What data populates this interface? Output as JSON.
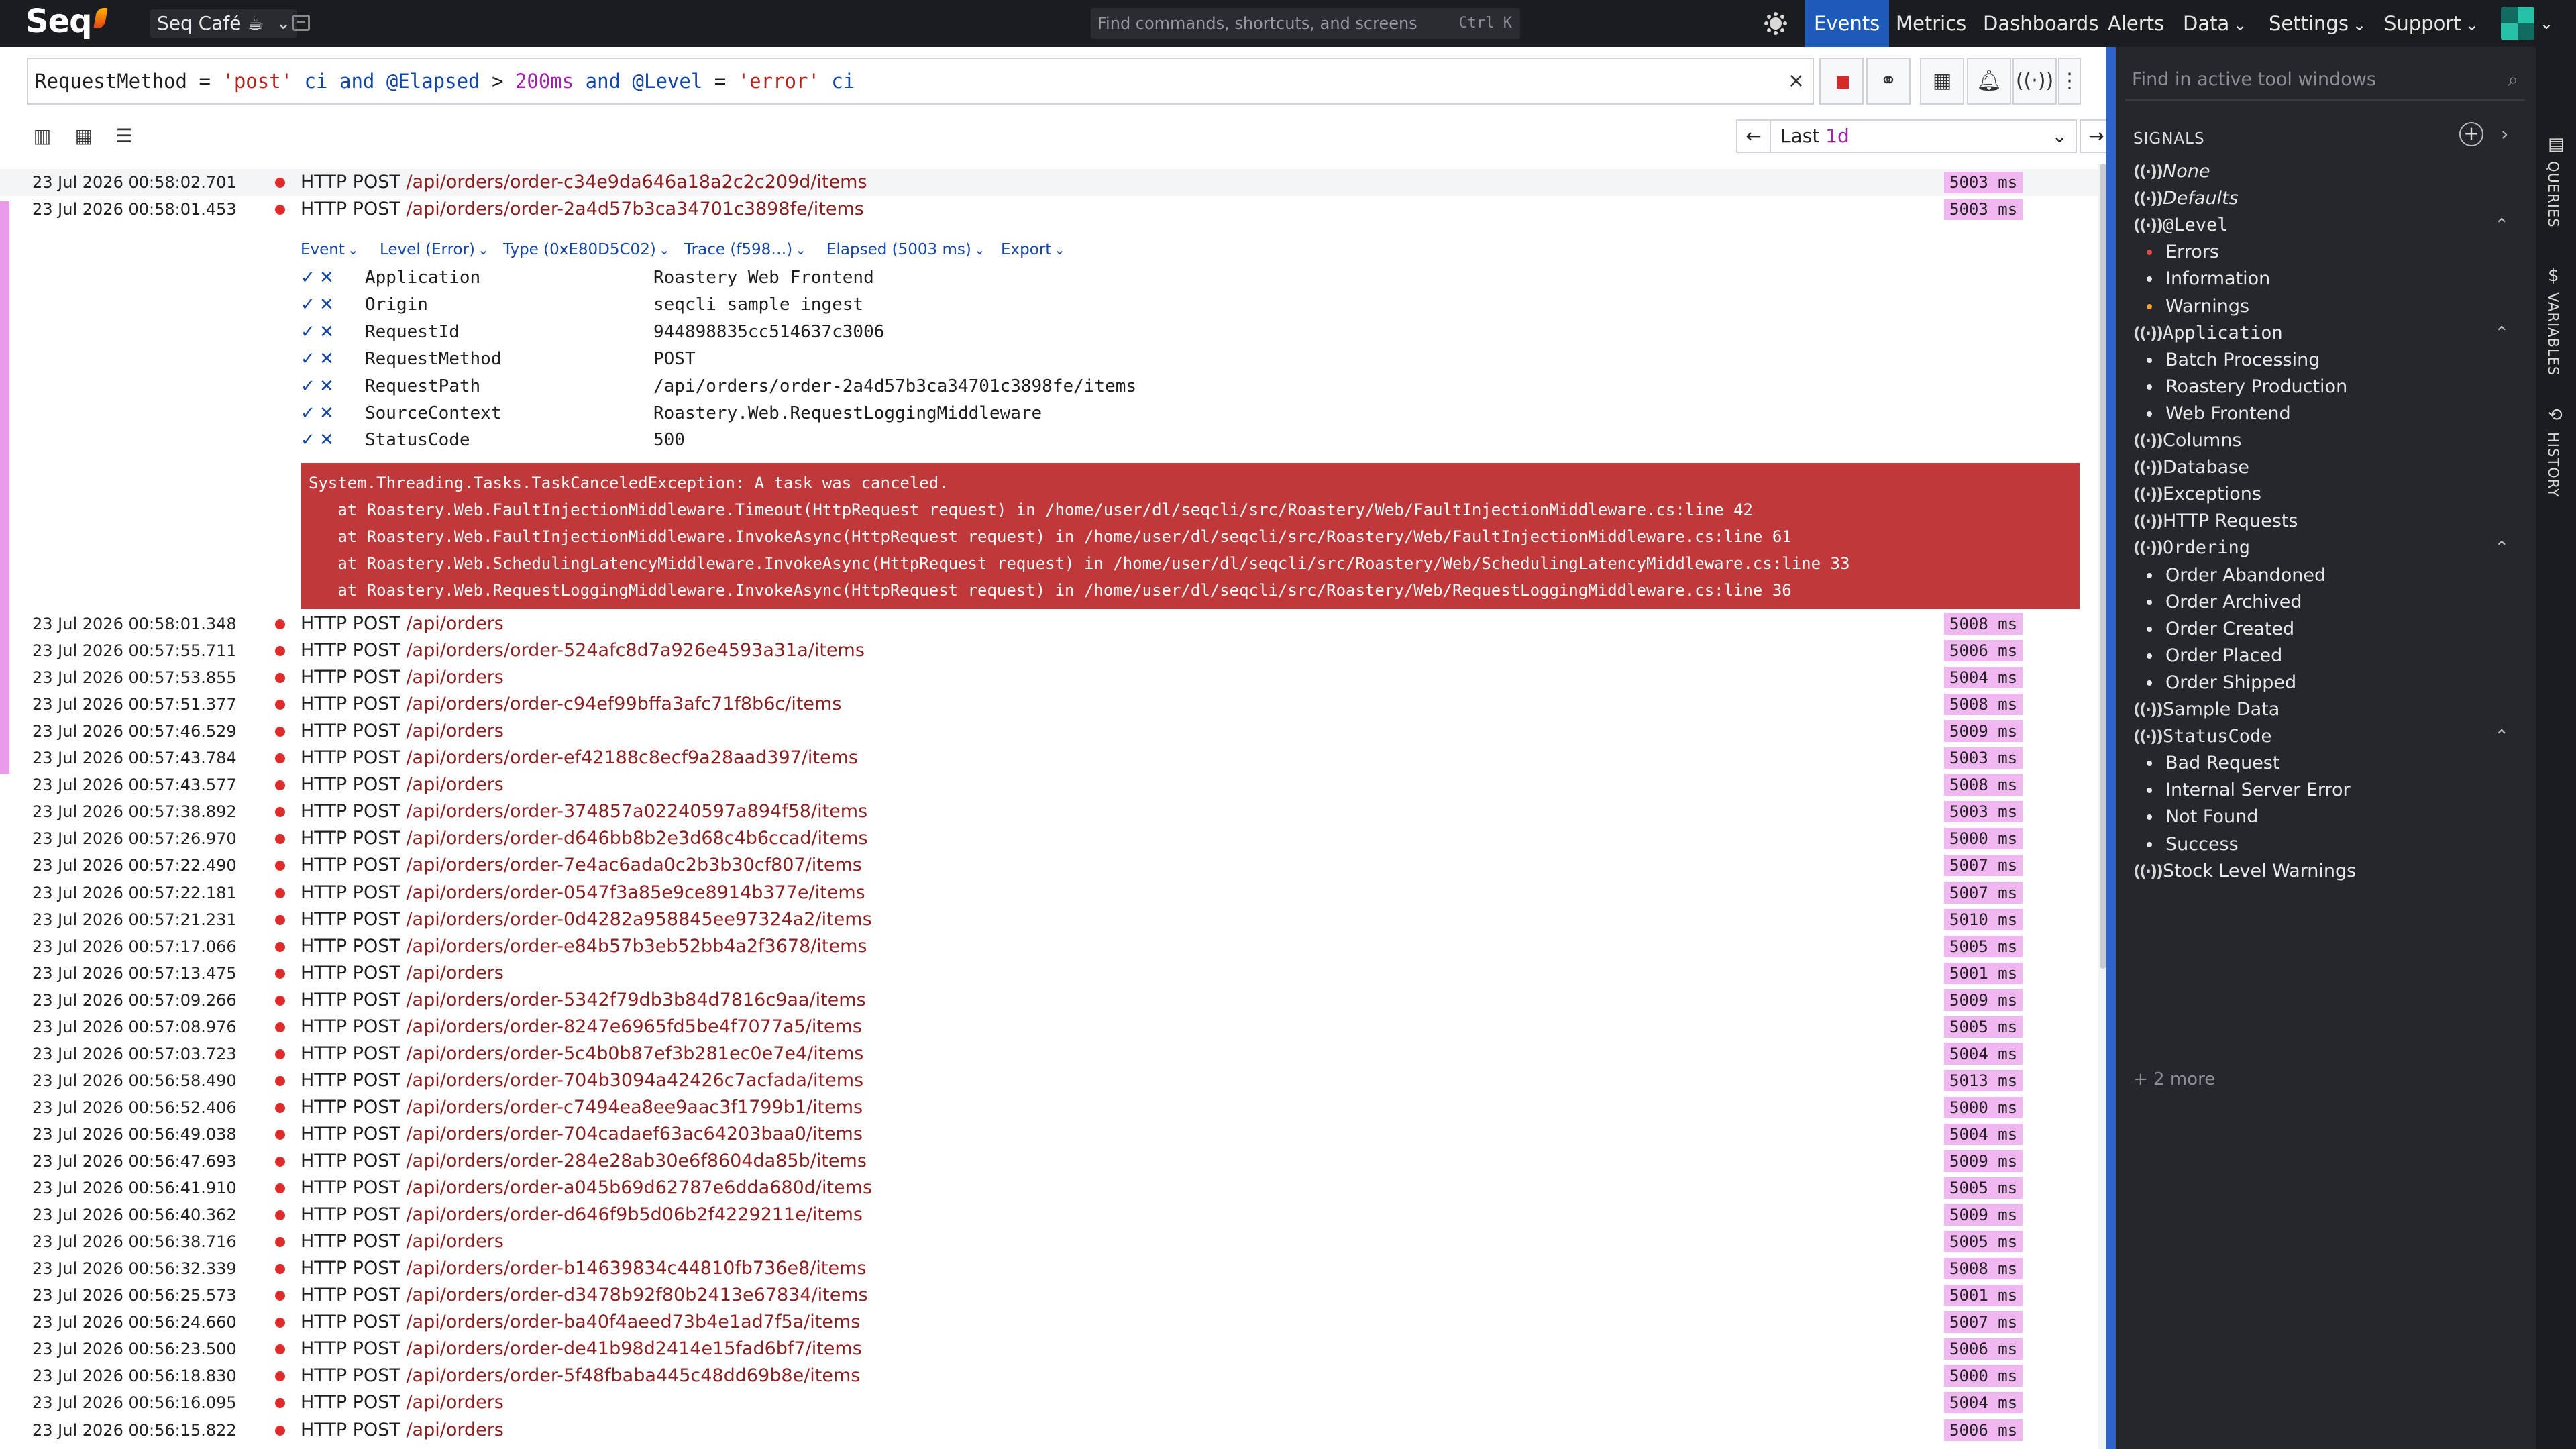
{
  "app": {
    "logo": "Seq",
    "workspace": "Seq Café ☕"
  },
  "command_search": {
    "placeholder": "Find commands, shortcuts, and screens",
    "shortcut": "Ctrl K"
  },
  "nav": {
    "items": [
      {
        "label": "Events",
        "active": true,
        "dropdown": false
      },
      {
        "label": "Metrics",
        "dropdown": false
      },
      {
        "label": "Dashboards",
        "dropdown": false
      },
      {
        "label": "Alerts",
        "dropdown": false
      },
      {
        "label": "Data",
        "dropdown": true
      },
      {
        "label": "Settings",
        "dropdown": true
      },
      {
        "label": "Support",
        "dropdown": true
      }
    ]
  },
  "query": {
    "tokens": [
      {
        "text": "RequestMethod",
        "kind": "plain"
      },
      {
        "text": " = ",
        "kind": "plain"
      },
      {
        "text": "'post'",
        "kind": "str"
      },
      {
        "text": " ci ",
        "kind": "kw"
      },
      {
        "text": "and",
        "kind": "kw"
      },
      {
        "text": " @Elapsed ",
        "kind": "kw"
      },
      {
        "text": "> ",
        "kind": "plain"
      },
      {
        "text": "200ms",
        "kind": "num"
      },
      {
        "text": " and ",
        "kind": "kw"
      },
      {
        "text": "@Level",
        "kind": "kw"
      },
      {
        "text": " = ",
        "kind": "plain"
      },
      {
        "text": "'error'",
        "kind": "str"
      },
      {
        "text": " ci",
        "kind": "kw"
      }
    ],
    "clear_icon": "×"
  },
  "range": {
    "prefix": "Last ",
    "value": "1d"
  },
  "expanded_event": {
    "tabs": [
      "Event",
      "Level (Error)",
      "Type (0xE80D5C02)",
      "Trace (f598…)",
      "Elapsed (5003 ms)",
      "Export"
    ],
    "properties": [
      {
        "name": "Application",
        "value": "Roastery Web Frontend"
      },
      {
        "name": "Origin",
        "value": "seqcli sample ingest"
      },
      {
        "name": "RequestId",
        "value": "944898835cc514637c3006"
      },
      {
        "name": "RequestMethod",
        "value": "POST"
      },
      {
        "name": "RequestPath",
        "value": "/api/orders/order-2a4d57b3ca34701c3898fe/items"
      },
      {
        "name": "SourceContext",
        "value": "Roastery.Web.RequestLoggingMiddleware"
      },
      {
        "name": "StatusCode",
        "value": "500"
      }
    ],
    "exception": [
      "System.Threading.Tasks.TaskCanceledException: A task was canceled.",
      "   at Roastery.Web.FaultInjectionMiddleware.Timeout(HttpRequest request) in /home/user/dl/seqcli/src/Roastery/Web/FaultInjectionMiddleware.cs:line 42",
      "   at Roastery.Web.FaultInjectionMiddleware.InvokeAsync(HttpRequest request) in /home/user/dl/seqcli/src/Roastery/Web/FaultInjectionMiddleware.cs:line 61",
      "   at Roastery.Web.SchedulingLatencyMiddleware.InvokeAsync(HttpRequest request) in /home/user/dl/seqcli/src/Roastery/Web/SchedulingLatencyMiddleware.cs:line 33",
      "   at Roastery.Web.RequestLoggingMiddleware.InvokeAsync(HttpRequest request) in /home/user/dl/seqcli/src/Roastery/Web/RequestLoggingMiddleware.cs:line 36"
    ]
  },
  "events": [
    {
      "ts": "23 Jul 2026  00:58:02.701",
      "method": "HTTP POST",
      "path": "/api/orders/order-c34e9da646a18a2c2c209d/items",
      "elapsed": "5003 ms"
    },
    {
      "ts": "23 Jul 2026  00:58:01.453",
      "method": "HTTP POST",
      "path": "/api/orders/order-2a4d57b3ca34701c3898fe/items",
      "elapsed": "5003 ms"
    },
    {
      "ts": "23 Jul 2026  00:58:01.348",
      "method": "HTTP POST",
      "path": "/api/orders",
      "elapsed": "5008 ms"
    },
    {
      "ts": "23 Jul 2026  00:57:55.711",
      "method": "HTTP POST",
      "path": "/api/orders/order-524afc8d7a926e4593a31a/items",
      "elapsed": "5006 ms"
    },
    {
      "ts": "23 Jul 2026  00:57:53.855",
      "method": "HTTP POST",
      "path": "/api/orders",
      "elapsed": "5004 ms"
    },
    {
      "ts": "23 Jul 2026  00:57:51.377",
      "method": "HTTP POST",
      "path": "/api/orders/order-c94ef99bffa3afc71f8b6c/items",
      "elapsed": "5008 ms"
    },
    {
      "ts": "23 Jul 2026  00:57:46.529",
      "method": "HTTP POST",
      "path": "/api/orders",
      "elapsed": "5009 ms"
    },
    {
      "ts": "23 Jul 2026  00:57:43.784",
      "method": "HTTP POST",
      "path": "/api/orders/order-ef42188c8ecf9a28aad397/items",
      "elapsed": "5003 ms"
    },
    {
      "ts": "23 Jul 2026  00:57:43.577",
      "method": "HTTP POST",
      "path": "/api/orders",
      "elapsed": "5008 ms"
    },
    {
      "ts": "23 Jul 2026  00:57:38.892",
      "method": "HTTP POST",
      "path": "/api/orders/order-374857a02240597a894f58/items",
      "elapsed": "5003 ms"
    },
    {
      "ts": "23 Jul 2026  00:57:26.970",
      "method": "HTTP POST",
      "path": "/api/orders/order-d646bb8b2e3d68c4b6ccad/items",
      "elapsed": "5000 ms"
    },
    {
      "ts": "23 Jul 2026  00:57:22.490",
      "method": "HTTP POST",
      "path": "/api/orders/order-7e4ac6ada0c2b3b30cf807/items",
      "elapsed": "5007 ms"
    },
    {
      "ts": "23 Jul 2026  00:57:22.181",
      "method": "HTTP POST",
      "path": "/api/orders/order-0547f3a85e9ce8914b377e/items",
      "elapsed": "5007 ms"
    },
    {
      "ts": "23 Jul 2026  00:57:21.231",
      "method": "HTTP POST",
      "path": "/api/orders/order-0d4282a958845ee97324a2/items",
      "elapsed": "5010 ms"
    },
    {
      "ts": "23 Jul 2026  00:57:17.066",
      "method": "HTTP POST",
      "path": "/api/orders/order-e84b57b3eb52bb4a2f3678/items",
      "elapsed": "5005 ms"
    },
    {
      "ts": "23 Jul 2026  00:57:13.475",
      "method": "HTTP POST",
      "path": "/api/orders",
      "elapsed": "5001 ms"
    },
    {
      "ts": "23 Jul 2026  00:57:09.266",
      "method": "HTTP POST",
      "path": "/api/orders/order-5342f79db3b84d7816c9aa/items",
      "elapsed": "5009 ms"
    },
    {
      "ts": "23 Jul 2026  00:57:08.976",
      "method": "HTTP POST",
      "path": "/api/orders/order-8247e6965fd5be4f7077a5/items",
      "elapsed": "5005 ms"
    },
    {
      "ts": "23 Jul 2026  00:57:03.723",
      "method": "HTTP POST",
      "path": "/api/orders/order-5c4b0b87ef3b281ec0e7e4/items",
      "elapsed": "5004 ms"
    },
    {
      "ts": "23 Jul 2026  00:56:58.490",
      "method": "HTTP POST",
      "path": "/api/orders/order-704b3094a42426c7acfada/items",
      "elapsed": "5013 ms"
    },
    {
      "ts": "23 Jul 2026  00:56:52.406",
      "method": "HTTP POST",
      "path": "/api/orders/order-c7494ea8ee9aac3f1799b1/items",
      "elapsed": "5000 ms"
    },
    {
      "ts": "23 Jul 2026  00:56:49.038",
      "method": "HTTP POST",
      "path": "/api/orders/order-704cadaef63ac64203baa0/items",
      "elapsed": "5004 ms"
    },
    {
      "ts": "23 Jul 2026  00:56:47.693",
      "method": "HTTP POST",
      "path": "/api/orders/order-284e28ab30e6f8604da85b/items",
      "elapsed": "5009 ms"
    },
    {
      "ts": "23 Jul 2026  00:56:41.910",
      "method": "HTTP POST",
      "path": "/api/orders/order-a045b69d62787e6dda680d/items",
      "elapsed": "5005 ms"
    },
    {
      "ts": "23 Jul 2026  00:56:40.362",
      "method": "HTTP POST",
      "path": "/api/orders/order-d646f9b5d06b2f4229211e/items",
      "elapsed": "5009 ms"
    },
    {
      "ts": "23 Jul 2026  00:56:38.716",
      "method": "HTTP POST",
      "path": "/api/orders",
      "elapsed": "5005 ms"
    },
    {
      "ts": "23 Jul 2026  00:56:32.339",
      "method": "HTTP POST",
      "path": "/api/orders/order-b14639834c44810fb736e8/items",
      "elapsed": "5008 ms"
    },
    {
      "ts": "23 Jul 2026  00:56:25.573",
      "method": "HTTP POST",
      "path": "/api/orders/order-d3478b92f80b2413e67834/items",
      "elapsed": "5001 ms"
    },
    {
      "ts": "23 Jul 2026  00:56:24.660",
      "method": "HTTP POST",
      "path": "/api/orders/order-ba40f4aeed73b4e1ad7f5a/items",
      "elapsed": "5007 ms"
    },
    {
      "ts": "23 Jul 2026  00:56:23.500",
      "method": "HTTP POST",
      "path": "/api/orders/order-de41b98d2414e15fad6bf7/items",
      "elapsed": "5006 ms"
    },
    {
      "ts": "23 Jul 2026  00:56:18.830",
      "method": "HTTP POST",
      "path": "/api/orders/order-5f48fbaba445c48dd69b8e/items",
      "elapsed": "5000 ms"
    },
    {
      "ts": "23 Jul 2026  00:56:16.095",
      "method": "HTTP POST",
      "path": "/api/orders",
      "elapsed": "5004 ms"
    },
    {
      "ts": "23 Jul 2026  00:56:15.822",
      "method": "HTTP POST",
      "path": "/api/orders",
      "elapsed": "5006 ms"
    }
  ],
  "side_panel": {
    "find_placeholder": "Find in active tool windows",
    "signals_title": "SIGNALS",
    "signals": [
      {
        "label": "None",
        "kind": "signal",
        "style": "italic"
      },
      {
        "label": "Defaults",
        "kind": "signal",
        "style": "italic"
      },
      {
        "label": "@Level",
        "kind": "group",
        "style": "mono"
      },
      {
        "label": "Errors",
        "kind": "child",
        "bullet_color": "#e04848"
      },
      {
        "label": "Information",
        "kind": "child",
        "bullet_color": "#e8e8e8"
      },
      {
        "label": "Warnings",
        "kind": "child",
        "bullet_color": "#f0a030"
      },
      {
        "label": "Application",
        "kind": "group",
        "style": "mono"
      },
      {
        "label": "Batch Processing",
        "kind": "child"
      },
      {
        "label": "Roastery Production",
        "kind": "child"
      },
      {
        "label": "Web Frontend",
        "kind": "child"
      },
      {
        "label": "Columns",
        "kind": "signal"
      },
      {
        "label": "Database",
        "kind": "signal"
      },
      {
        "label": "Exceptions",
        "kind": "signal"
      },
      {
        "label": "HTTP Requests",
        "kind": "signal"
      },
      {
        "label": "Ordering",
        "kind": "group",
        "style": "mono"
      },
      {
        "label": "Order Abandoned",
        "kind": "child"
      },
      {
        "label": "Order Archived",
        "kind": "child"
      },
      {
        "label": "Order Created",
        "kind": "child"
      },
      {
        "label": "Order Placed",
        "kind": "child"
      },
      {
        "label": "Order Shipped",
        "kind": "child"
      },
      {
        "label": "Sample Data",
        "kind": "signal"
      },
      {
        "label": "StatusCode",
        "kind": "group",
        "style": "mono"
      },
      {
        "label": "Bad Request",
        "kind": "child"
      },
      {
        "label": "Internal Server Error",
        "kind": "child"
      },
      {
        "label": "Not Found",
        "kind": "child"
      },
      {
        "label": "Success",
        "kind": "child"
      },
      {
        "label": "Stock Level Warnings",
        "kind": "signal"
      }
    ],
    "more": "+ 2 more"
  },
  "vertical_tabs": [
    "QUERIES",
    "VARIABLES",
    "HISTORY"
  ],
  "colors": {
    "accent": "#1e5bb8",
    "error_dot": "#de2b2b",
    "elapsed_bg": "#f0b7f0",
    "exception_bg": "#c0393a"
  }
}
